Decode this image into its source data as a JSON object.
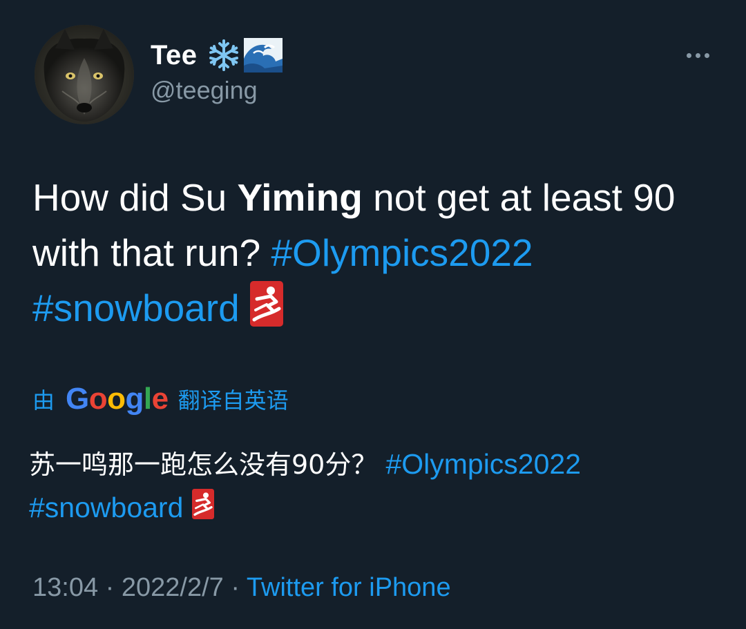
{
  "author": {
    "display_name": "Tee",
    "handle": "@teeging",
    "name_emoji": [
      "snowflake-icon",
      "wave-icon"
    ]
  },
  "tweet": {
    "text_part1": "How did Su ",
    "text_bold": "Yiming",
    "text_part2": " not get at least 90 with that run? ",
    "hashtag1": "#Olympics2022",
    "hashtag2": "#snowboard",
    "emoji": "snowboarder-icon"
  },
  "translation": {
    "prefix": "由",
    "provider": "Google",
    "suffix": "翻译自英语",
    "text": "苏一鸣那一跑怎么没有90分？ ",
    "hashtag1": "#Olympics2022",
    "hashtag2": "#snowboard"
  },
  "meta": {
    "time": "13:04",
    "separator1": " · ",
    "date": "2022/2/7",
    "separator2": " · ",
    "source": "Twitter for iPhone"
  },
  "colors": {
    "background": "#141f2a",
    "link": "#1d9bf0",
    "secondary_text": "#8899a6"
  }
}
